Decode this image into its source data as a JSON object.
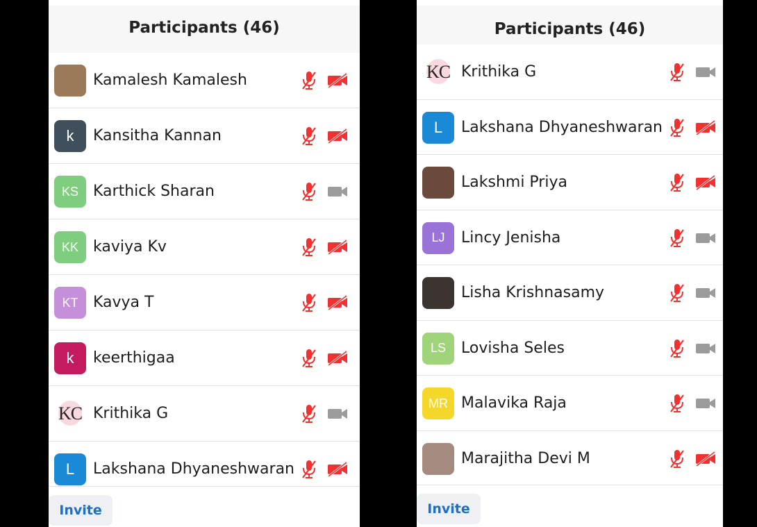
{
  "colors": {
    "muted_red": "#f0312f",
    "video_off_red": "#f0312f",
    "video_on_gray": "#9b9b9b",
    "invite_blue": "#1f6fc4"
  },
  "left_panel": {
    "title": "Participants (46)",
    "invite_label": "Invite",
    "participants": [
      {
        "name": "Kamalesh Kamalesh",
        "avatar": {
          "type": "photo",
          "color": "#9a7a58",
          "text": ""
        },
        "muted": true,
        "video_off": true
      },
      {
        "name": "Kansitha Kannan",
        "avatar": {
          "type": "letter",
          "color": "#3f4f5c",
          "text": "k"
        },
        "muted": true,
        "video_off": true
      },
      {
        "name": "Karthick Sharan",
        "avatar": {
          "type": "initials",
          "color": "#7fcd7f",
          "text": "KS"
        },
        "muted": true,
        "video_off": false
      },
      {
        "name": "kaviya Kv",
        "avatar": {
          "type": "initials",
          "color": "#7fcd7f",
          "text": "KK"
        },
        "muted": true,
        "video_off": true
      },
      {
        "name": "Kavya T",
        "avatar": {
          "type": "initials",
          "color": "#c68fd9",
          "text": "KT"
        },
        "muted": true,
        "video_off": true
      },
      {
        "name": "keerthigaa",
        "avatar": {
          "type": "letter",
          "color": "#c31b5e",
          "text": "k"
        },
        "muted": true,
        "video_off": true
      },
      {
        "name": "Krithika G",
        "avatar": {
          "type": "kc",
          "color": "#f6cfd8",
          "text": "KC"
        },
        "muted": true,
        "video_off": false
      },
      {
        "name": "Lakshana Dhyaneshwaran",
        "avatar": {
          "type": "letter",
          "color": "#1b8ad6",
          "text": "L"
        },
        "muted": true,
        "video_off": true
      }
    ]
  },
  "right_panel": {
    "title": "Participants (46)",
    "invite_label": "Invite",
    "participants": [
      {
        "name": "Krithika G",
        "avatar": {
          "type": "kc",
          "color": "#f6cfd8",
          "text": "KC"
        },
        "muted": true,
        "video_off": false
      },
      {
        "name": "Lakshana Dhyaneshwaran",
        "avatar": {
          "type": "letter",
          "color": "#1b8ad6",
          "text": "L"
        },
        "muted": true,
        "video_off": true
      },
      {
        "name": "Lakshmi Priya",
        "avatar": {
          "type": "photo",
          "color": "#6b4a3c",
          "text": ""
        },
        "muted": true,
        "video_off": true
      },
      {
        "name": "Lincy Jenisha",
        "avatar": {
          "type": "initials",
          "color": "#9a72d8",
          "text": "LJ"
        },
        "muted": true,
        "video_off": false
      },
      {
        "name": "Lisha Krishnasamy",
        "avatar": {
          "type": "photo",
          "color": "#3b3430",
          "text": ""
        },
        "muted": true,
        "video_off": false
      },
      {
        "name": "Lovisha Seles",
        "avatar": {
          "type": "initials",
          "color": "#9fd47a",
          "text": "LS"
        },
        "muted": true,
        "video_off": false
      },
      {
        "name": "Malavika Raja",
        "avatar": {
          "type": "initials",
          "color": "#f5d72a",
          "text": "MR"
        },
        "muted": true,
        "video_off": false
      },
      {
        "name": "Marajitha Devi M",
        "avatar": {
          "type": "photo",
          "color": "#a58a80",
          "text": ""
        },
        "muted": true,
        "video_off": true
      }
    ]
  }
}
